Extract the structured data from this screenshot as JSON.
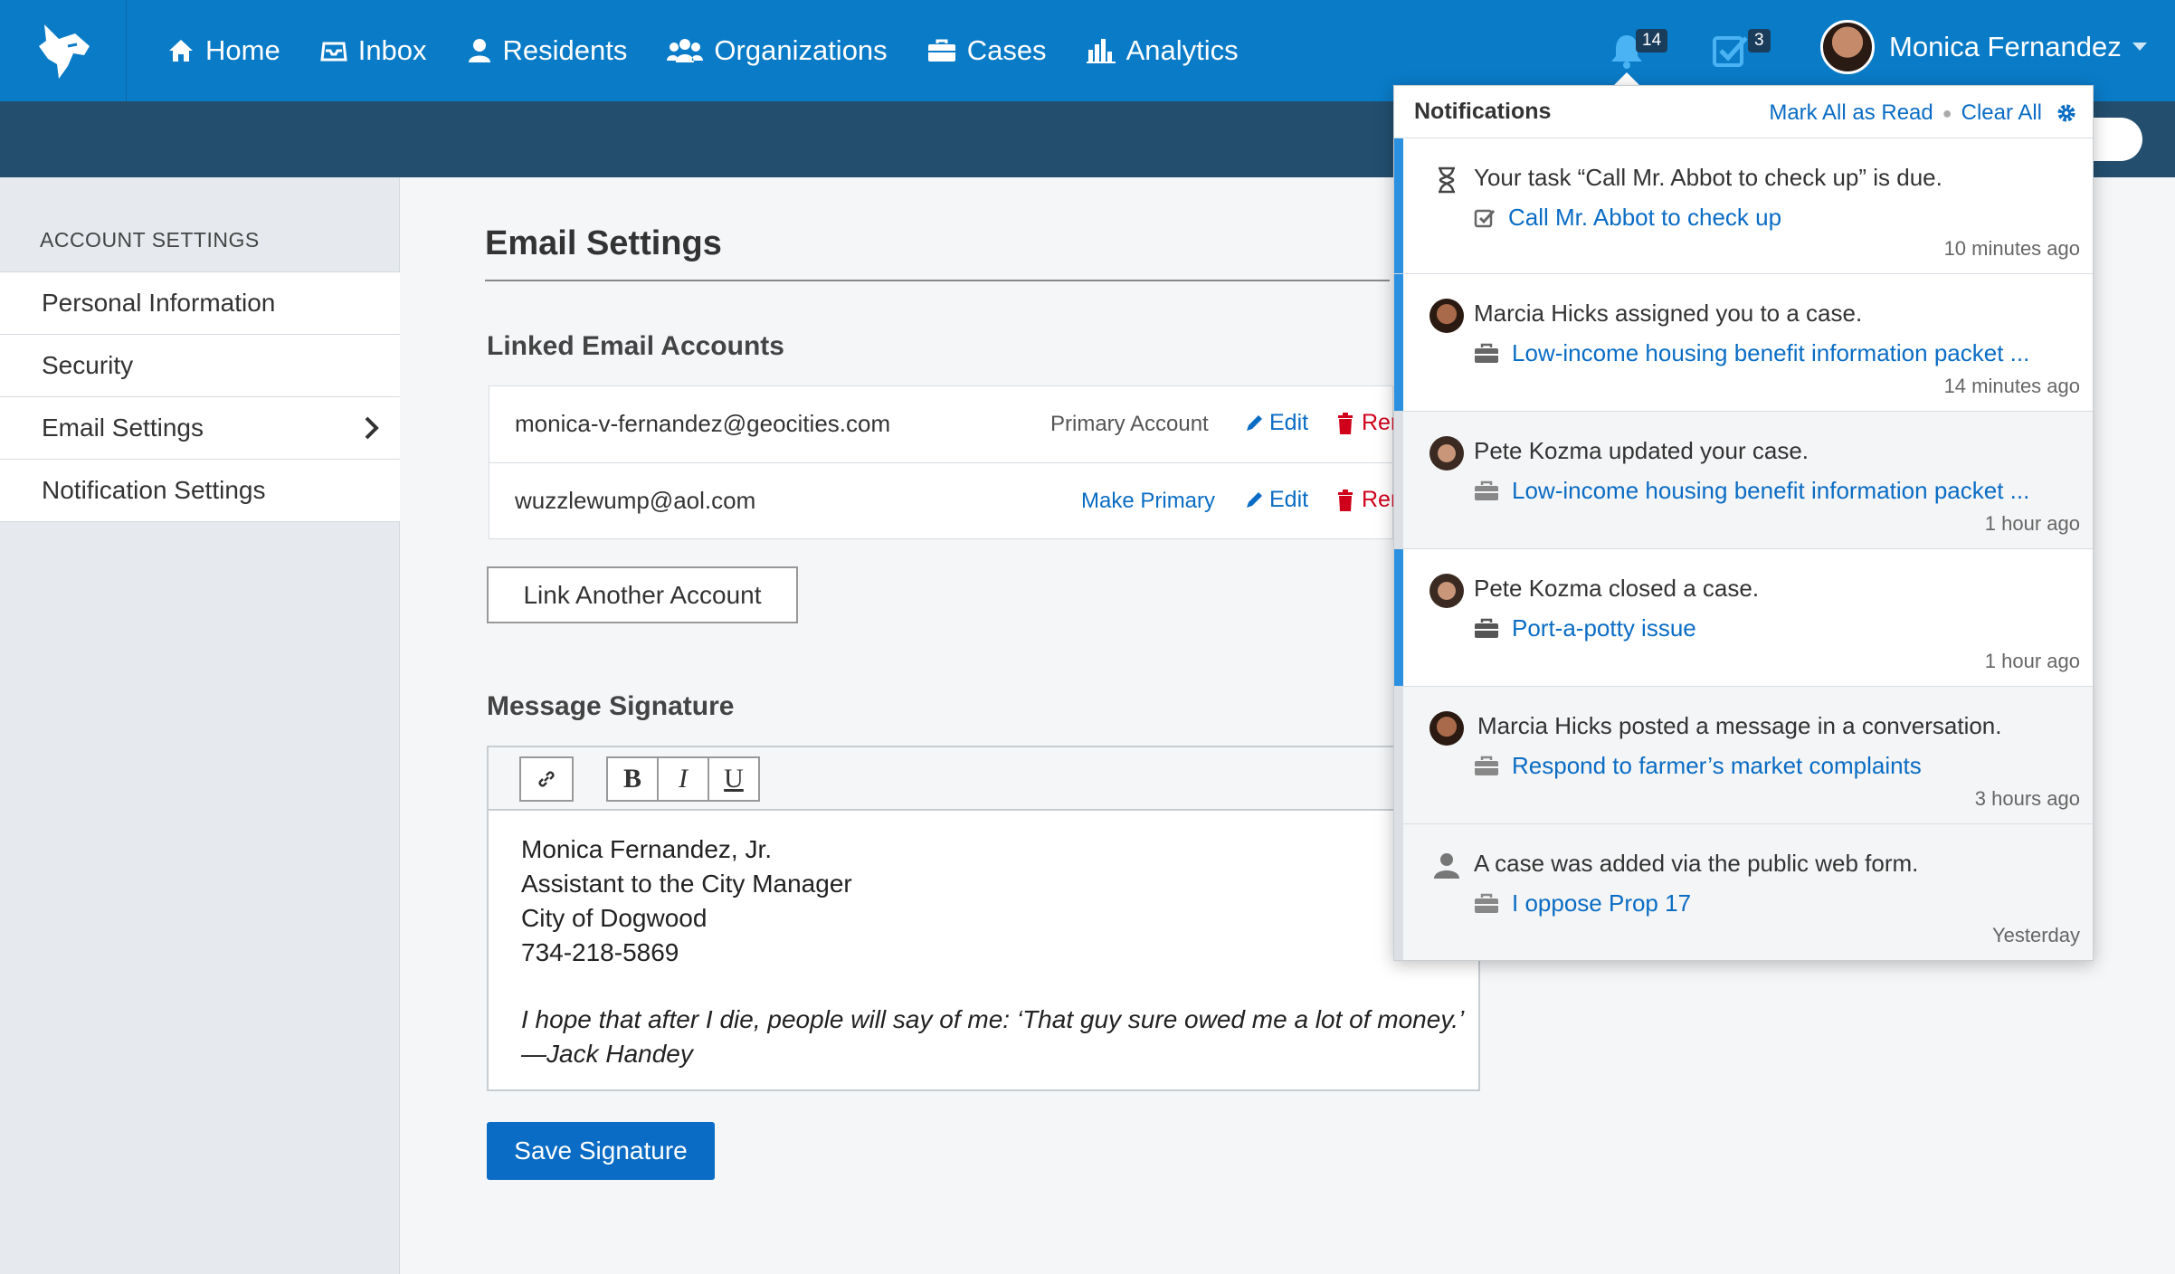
{
  "nav": {
    "items": [
      {
        "label": "Home",
        "icon": "home-icon"
      },
      {
        "label": "Inbox",
        "icon": "inbox-icon"
      },
      {
        "label": "Residents",
        "icon": "person-icon"
      },
      {
        "label": "Organizations",
        "icon": "group-icon"
      },
      {
        "label": "Cases",
        "icon": "briefcase-icon"
      },
      {
        "label": "Analytics",
        "icon": "bar-chart-icon"
      }
    ],
    "notification_count": "14",
    "task_count": "3",
    "user_name": "Monica Fernandez"
  },
  "sidebar": {
    "heading": "ACCOUNT SETTINGS",
    "items": [
      {
        "label": "Personal Information"
      },
      {
        "label": "Security"
      },
      {
        "label": "Email Settings",
        "active": true
      },
      {
        "label": "Notification Settings"
      }
    ]
  },
  "main": {
    "title": "Email Settings",
    "linked_heading": "Linked Email Accounts",
    "accounts": [
      {
        "email": "monica-v-fernandez@geocities.com",
        "status": "Primary Account",
        "edit": "Edit",
        "remove": "Rer"
      },
      {
        "email": "wuzzlewump@aol.com",
        "status": "Make Primary",
        "edit": "Edit",
        "remove": "Rer"
      }
    ],
    "link_button": "Link Another Account",
    "signature_heading": "Message Signature",
    "toolbar": {
      "bold": "B",
      "italic": "I",
      "underline": "U"
    },
    "signature_lines": [
      "Monica Fernandez, Jr.",
      "Assistant to the City Manager",
      "City of Dogwood",
      "734-218-5869"
    ],
    "signature_quote": [
      "I hope that after I die, people will say of me: ‘That guy sure owed me a lot of money.’",
      "—Jack Handey"
    ],
    "save_button": "Save Signature"
  },
  "notifications": {
    "title": "Notifications",
    "mark_all": "Mark All as Read",
    "clear_all": "Clear All",
    "items": [
      {
        "text": "Your task “Call Mr. Abbot to check up” is due.",
        "link": "Call Mr. Abbot to check up",
        "time": "10 minutes ago",
        "unread": true,
        "icon": "hourglass-icon",
        "link_icon": "task-check-icon"
      },
      {
        "text": "Marcia Hicks assigned you to a case.",
        "link": "Low-income housing benefit information packet ...",
        "time": "14 minutes ago",
        "unread": true,
        "icon": "avatar-marcia",
        "link_icon": "briefcase-icon"
      },
      {
        "text": "Pete Kozma updated your case.",
        "link": "Low-income housing benefit information packet ...",
        "time": "1 hour ago",
        "unread": false,
        "icon": "avatar-pete",
        "link_icon": "briefcase-icon"
      },
      {
        "text": "Pete Kozma closed a case.",
        "link": "Port-a-potty issue",
        "time": "1 hour ago",
        "unread": true,
        "icon": "avatar-pete",
        "link_icon": "briefcase-icon"
      },
      {
        "text": "Marcia Hicks posted a message in a conversation.",
        "link": "Respond to farmer’s market complaints",
        "time": "3 hours ago",
        "unread": false,
        "icon": "avatar-marcia",
        "link_icon": "briefcase-icon"
      },
      {
        "text": "A case was added via the public web form.",
        "link": "I oppose Prop 17",
        "time": "Yesterday",
        "unread": false,
        "icon": "person-icon",
        "link_icon": "briefcase-icon"
      }
    ]
  },
  "colors": {
    "brand": "#0a7bc7",
    "subbar": "#234e6e",
    "link": "#0a6cc4",
    "danger": "#d0021b",
    "unread_bar": "#2b90df"
  }
}
